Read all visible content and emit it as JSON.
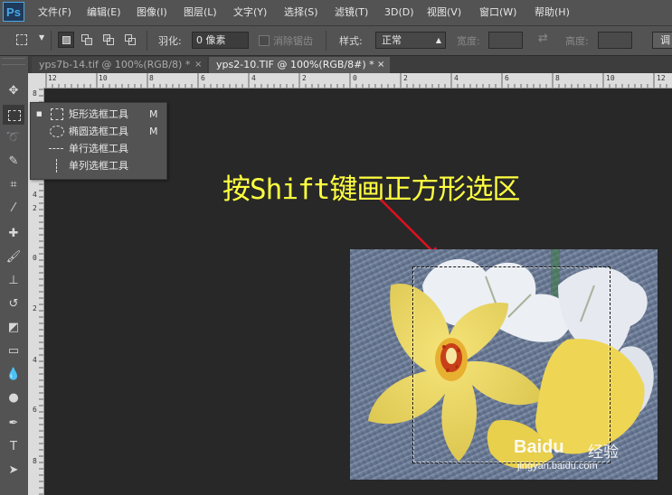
{
  "app": {
    "logo": "Ps"
  },
  "menu": [
    "文件(F)",
    "编辑(E)",
    "图像(I)",
    "图层(L)",
    "文字(Y)",
    "选择(S)",
    "滤镜(T)",
    "3D(D)",
    "视图(V)",
    "窗口(W)",
    "帮助(H)"
  ],
  "options": {
    "feather_label": "羽化:",
    "feather_value": "0 像素",
    "antialias_label": "消除锯齿",
    "style_label": "样式:",
    "style_value": "正常",
    "width_label": "宽度:",
    "height_label": "高度:",
    "refine_button": "调"
  },
  "tabs": [
    {
      "label": "yps7b-14.tif @ 100%(RGB/8) *",
      "active": false
    },
    {
      "label": "yps2-10.TIF @ 100%(RGB/8#) *",
      "active": true
    }
  ],
  "tab_close": "×",
  "ruler_top": [
    "12",
    "10",
    "8",
    "6",
    "4",
    "2",
    "0",
    "2",
    "4",
    "6",
    "8",
    "10",
    "12"
  ],
  "ruler_left": [
    "8",
    "6",
    "4",
    "2",
    "0",
    "2",
    "4",
    "6",
    "8"
  ],
  "flyout": [
    {
      "label": "矩形选框工具",
      "key": "M",
      "selected": true,
      "icon": "rect-marquee-icon"
    },
    {
      "label": "椭圆选框工具",
      "key": "M",
      "selected": false,
      "icon": "ellipse-marquee-icon"
    },
    {
      "label": "单行选框工具",
      "key": "",
      "selected": false,
      "icon": "single-row-marquee-icon"
    },
    {
      "label": "单列选框工具",
      "key": "",
      "selected": false,
      "icon": "single-column-marquee-icon"
    }
  ],
  "annotation": "按Shift键画正方形选区",
  "watermark": {
    "brand": "Baidu",
    "sub": "经验",
    "url": "jingyan.baidu.com"
  },
  "colors": {
    "annotation": "#ffff40",
    "app_bg": "#282828",
    "panel": "#535353",
    "logo": "#4aa8e6"
  }
}
